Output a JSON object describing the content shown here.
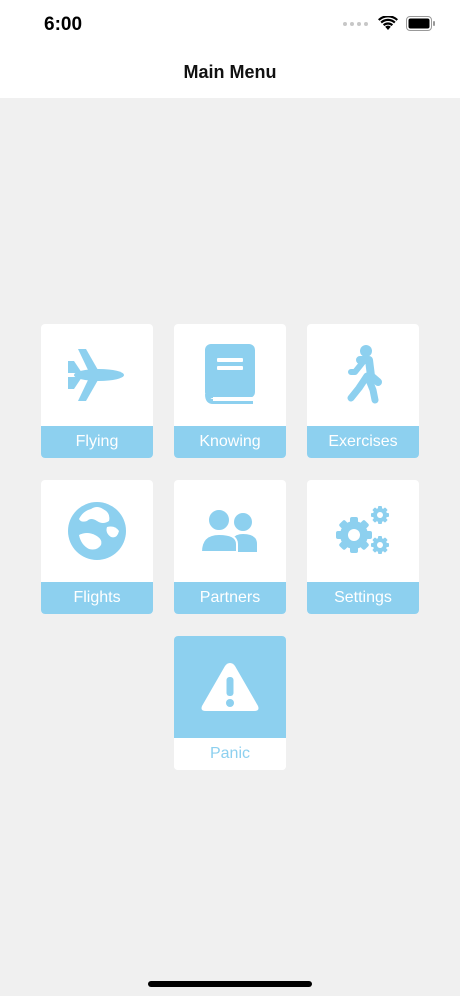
{
  "status": {
    "time": "6:00"
  },
  "nav": {
    "title": "Main Menu"
  },
  "colors": {
    "accent": "#8dd0ef",
    "background": "#f0f0f0",
    "tile": "#ffffff"
  },
  "menu": {
    "tiles": [
      {
        "label": "Flying",
        "icon": "airplane-icon"
      },
      {
        "label": "Knowing",
        "icon": "book-icon"
      },
      {
        "label": "Exercises",
        "icon": "walking-person-icon"
      },
      {
        "label": "Flights",
        "icon": "globe-icon"
      },
      {
        "label": "Partners",
        "icon": "people-icon"
      },
      {
        "label": "Settings",
        "icon": "gears-icon"
      },
      {
        "label": "Panic",
        "icon": "warning-icon"
      }
    ]
  }
}
